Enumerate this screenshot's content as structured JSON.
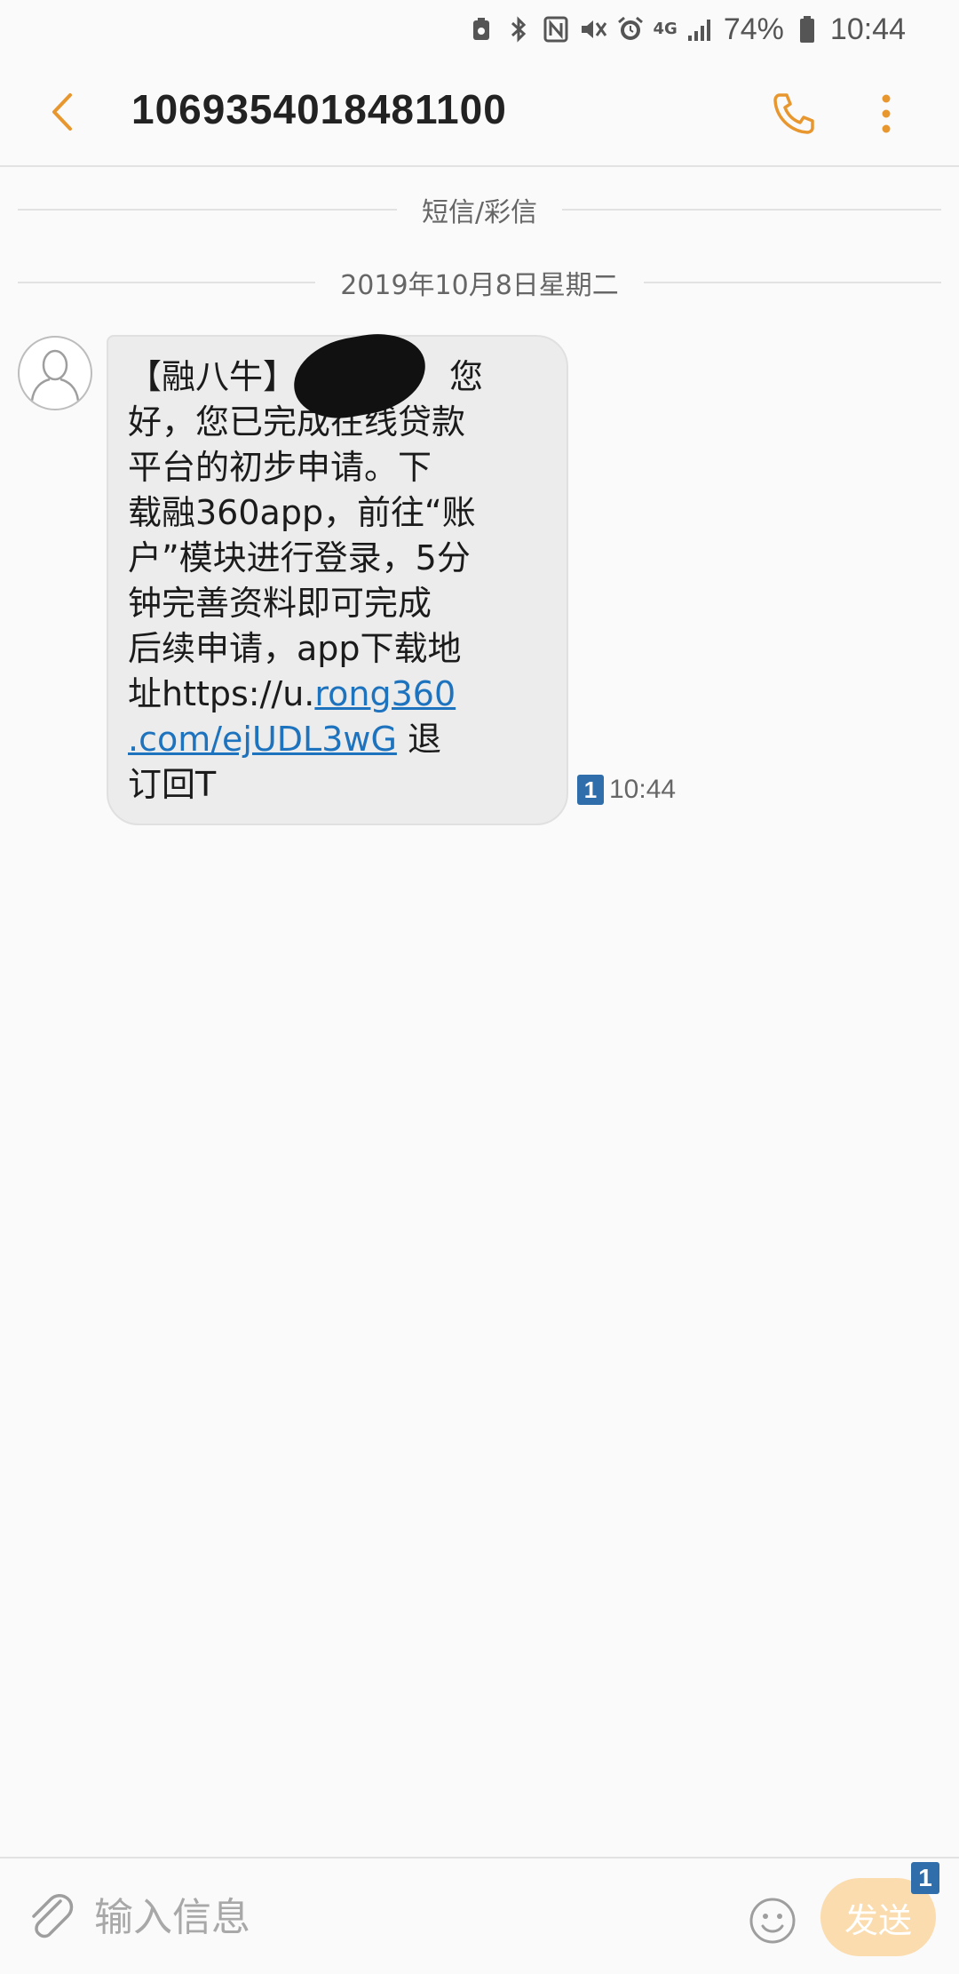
{
  "status_bar": {
    "network": "4G",
    "battery": "74%",
    "time": "10:44"
  },
  "header": {
    "title": "1069354018481100"
  },
  "thread": {
    "type_label": "短信/彩信",
    "date_label": "2019年10月8日星期二"
  },
  "message": {
    "line1": "【融八牛】",
    "line1_end": "您",
    "line2": "好，您已完成在线贷款",
    "line3": "平台的初步申请。下",
    "line4": "载融360app，前往“账",
    "line5": "户”模块进行登录，5分",
    "line6": "钟完善资料即可完成",
    "line7": "后续申请，app下载地",
    "line8_prefix": "址https://u.",
    "link_part1": "rong360",
    "link_part2": ".com/ejUDL3wG",
    "line9_suffix": " 退",
    "line10": "订回T",
    "sim": "1",
    "time": "10:44"
  },
  "composer": {
    "placeholder": "输入信息",
    "send_label": "发送",
    "sim": "1"
  },
  "colors": {
    "accent": "#e8972f",
    "link": "#1e73be",
    "sim_badge": "#2f6eaa",
    "send_button": "#fbdcae"
  },
  "icons": [
    "back-arrow-icon",
    "phone-icon",
    "more-vert-icon",
    "paperclip-icon",
    "emoji-icon",
    "avatar-icon",
    "bluetooth-icon",
    "nfc-icon",
    "mute-icon",
    "alarm-icon",
    "signal-icon",
    "battery-icon"
  ]
}
